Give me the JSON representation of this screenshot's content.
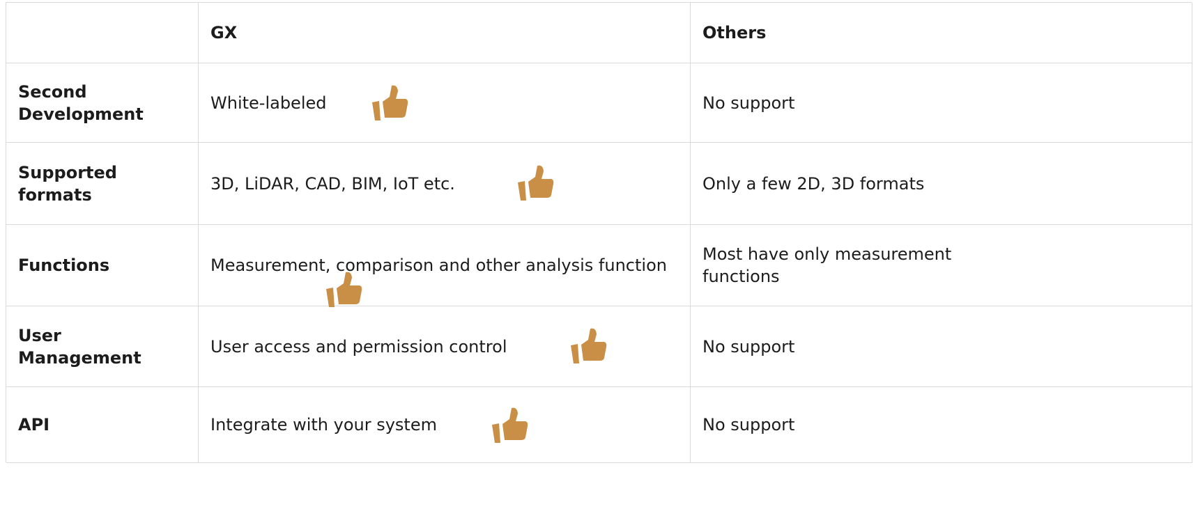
{
  "table": {
    "headers": [
      "",
      "GX",
      "Others"
    ],
    "rows": [
      {
        "feature": "Second Development",
        "gx": "White-labeled",
        "others": "No support"
      },
      {
        "feature": "Supported formats",
        "gx": "3D, LiDAR, CAD, BIM, IoT etc.",
        "others": "Only a few 2D, 3D formats"
      },
      {
        "feature": "Functions",
        "gx": "Measurement, comparison and other analysis function",
        "others": "Most have only measurement functions"
      },
      {
        "feature": "User Management",
        "gx": "User access and permission control",
        "others": "No support"
      },
      {
        "feature": "API",
        "gx": "Integrate with your system",
        "others": "No support"
      }
    ]
  },
  "icons": {
    "thumb": "thumbs-up-icon",
    "thumb_color": "#c98f47"
  }
}
